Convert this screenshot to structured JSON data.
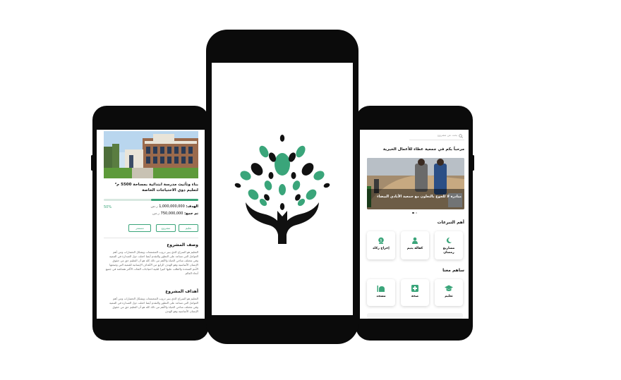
{
  "left_screen": {
    "project_title": "بناء وتأثيث مدرسة ابتدائية بمساحة 5500 م² لتعليم ذوي الاحتياجات الخاصة",
    "progress_percent_label": "50%",
    "progress_fraction": 0.5,
    "goal_label": "الهدف:",
    "goal_value": "1,000,000,000",
    "collected_label": "تم جمع:",
    "collected_value": "750,000,000",
    "currency": "ر.س",
    "tags": [
      "تعليم",
      "مشروع",
      "مستمر"
    ],
    "description_heading": "وصف المشروع",
    "description_text": "التعليم هو السراج الذي ينير دروب المجتمعات ويشكل الحضارات ومن أهم العوامل التي تساعد على التطور والتقدم أيضا احتلت دول الصدارة في التنمية وفي مختلف مناحي الحياة والأهم من ذلك كله هو أن التعليم حق من حقوق الإنسان الأساسية وهو الهدف الرابع من الأهداف الإنسانية للتنمية التي وضعتها الأمم المتحدة والطلب عليها كبيرا لتلبية احتياجات الفئات الأكثر هشاشة في جميع أنحاء العالم",
    "goals_heading": "أهداف المشروع",
    "goals_text": "التعليم هو السراج الذي ينير دروب المجتمعات ويشكل الحضارات ومن أهم العوامل التي تساعد على التطور والتقدم أيضا احتلت دول الصدارة في التنمية وفي مختلف مناحي الحياة والأهم من ذلك كله هو أن التعليم حق من حقوق الإنسان الأساسية وهو الهدف"
  },
  "right_screen": {
    "search_placeholder": "بحث عن مشروع",
    "welcome": "مرحباً بكم في جمعية عطاء للأعمال الخيرية",
    "banner_caption": "مبادرة لا للجوع بالتعاون مع جمعية الأيادي البيضاء",
    "section_donations": "أهم التبرعات",
    "donations": [
      {
        "label": "مشاريع رمضان",
        "icon": "moon-icon"
      },
      {
        "label": "كفالة يتيم",
        "icon": "person-icon"
      },
      {
        "label": "إخراج زكاة",
        "icon": "coin-bag-icon"
      }
    ],
    "section_contribute": "ساهم معنا",
    "contribute": [
      {
        "label": "تعليم",
        "icon": "graduation-cap-icon"
      },
      {
        "label": "صحة",
        "icon": "medical-cross-icon"
      },
      {
        "label": "مسجد",
        "icon": "mosque-icon"
      }
    ]
  },
  "colors": {
    "brand_green": "#3aa57a",
    "dark": "#111111"
  }
}
